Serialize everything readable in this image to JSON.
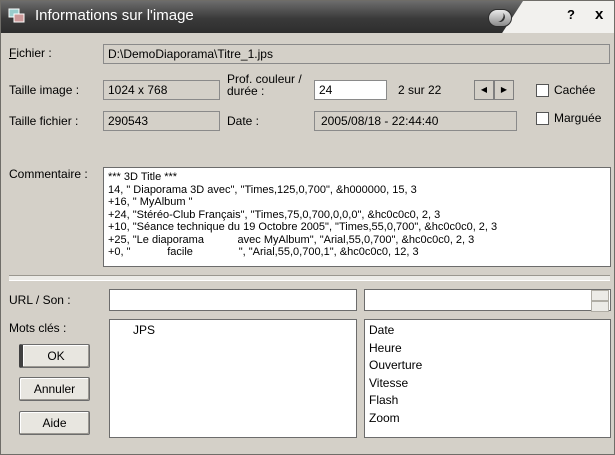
{
  "window": {
    "title": "Informations sur l'image",
    "help_label": "?",
    "close_label": "x"
  },
  "fichier": {
    "label": "Fichier :",
    "value": "D:\\DemoDiaporama\\Titre_1.jps"
  },
  "taille_image": {
    "label": "Taille image :",
    "value": "1024 x 768"
  },
  "prof_couleur": {
    "label_line1": "Prof. couleur /",
    "label_line2": "durée :",
    "value": "24"
  },
  "position": {
    "text": "2 sur 22",
    "prev_label": "◀",
    "next_label": "▶"
  },
  "cachee": {
    "label": "Cachée",
    "checked": false
  },
  "taille_fichier": {
    "label": "Taille fichier :",
    "value": "290543"
  },
  "date": {
    "label": "Date :",
    "value": "2005/08/18 - 22:44:40"
  },
  "marquee": {
    "label": "Marguée",
    "checked": false
  },
  "commentaire": {
    "label": "Commentaire :",
    "lines": [
      "*** 3D Title ***",
      "14, \" Diaporama 3D avec\", \"Times,125,0,700\", &h000000, 15, 3",
      "+16, \" MyAlbum \"",
      "+24, \"Stéréo-Club Français\", \"Times,75,0,700,0,0,0\", &hc0c0c0, 2, 3",
      "+10, \"Séance technique du 19 Octobre 2005\", \"Times,55,0,700\", &hc0c0c0, 2, 3",
      "+25, \"Le diaporama           avec MyAlbum\", \"Arial,55,0,700\", &hc0c0c0, 2, 3",
      "+0, \"            facile               \", \"Arial,55,0,700,1\", &hc0c0c0, 12, 3"
    ]
  },
  "url_son": {
    "label": "URL / Son :",
    "value": "",
    "value2": ""
  },
  "mots_cles": {
    "label": "Mots clés :",
    "values": [
      "JPS"
    ],
    "fields": [
      "Date",
      "Heure",
      "Ouverture",
      "Vitesse",
      "Flash",
      "Zoom"
    ]
  },
  "buttons": {
    "ok": "OK",
    "annuler": "Annuler",
    "aide": "Aide"
  }
}
